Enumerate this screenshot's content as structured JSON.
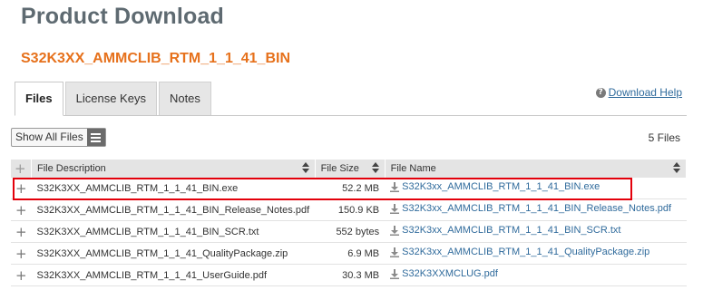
{
  "header": {
    "title": "Product Download",
    "product_name": "S32K3XX_AMMCLIB_RTM_1_1_41_BIN"
  },
  "tabs": [
    {
      "label": "Files",
      "active": true
    },
    {
      "label": "License Keys",
      "active": false
    },
    {
      "label": "Notes",
      "active": false
    }
  ],
  "help": {
    "icon": "question-icon",
    "label": "Download Help"
  },
  "toolbar": {
    "show_all_label": "Show All Files",
    "file_count": "5 Files"
  },
  "table": {
    "columns": [
      "File Description",
      "File Size",
      "File Name"
    ],
    "rows": [
      {
        "description": "S32K3XX_AMMCLIB_RTM_1_1_41_BIN.exe",
        "size": "52.2 MB",
        "file": "S32K3xx_AMMCLIB_RTM_1_1_41_BIN.exe",
        "highlighted": true
      },
      {
        "description": "S32K3XX_AMMCLIB_RTM_1_1_41_BIN_Release_Notes.pdf",
        "size": "150.9 KB",
        "file": "S32K3xx_AMMCLIB_RTM_1_1_41_BIN_Release_Notes.pdf",
        "highlighted": false
      },
      {
        "description": "S32K3XX_AMMCLIB_RTM_1_1_41_BIN_SCR.txt",
        "size": "552 bytes",
        "file": "S32K3xx_AMMCLIB_RTM_1_1_41_BIN_SCR.txt",
        "highlighted": false
      },
      {
        "description": "S32K3XX_AMMCLIB_RTM_1_1_41_QualityPackage.zip",
        "size": "6.9 MB",
        "file": "S32K3xx_AMMCLIB_RTM_1_1_41_QualityPackage.zip",
        "highlighted": false
      },
      {
        "description": "S32K3XX_AMMCLIB_RTM_1_1_41_UserGuide.pdf",
        "size": "30.3 MB",
        "file": "S32K3XXMCLUG.pdf",
        "highlighted": false
      }
    ]
  },
  "colors": {
    "title": "#5e6a71",
    "product": "#e6711c",
    "link": "#306b9c",
    "highlight": "#e3000b"
  }
}
